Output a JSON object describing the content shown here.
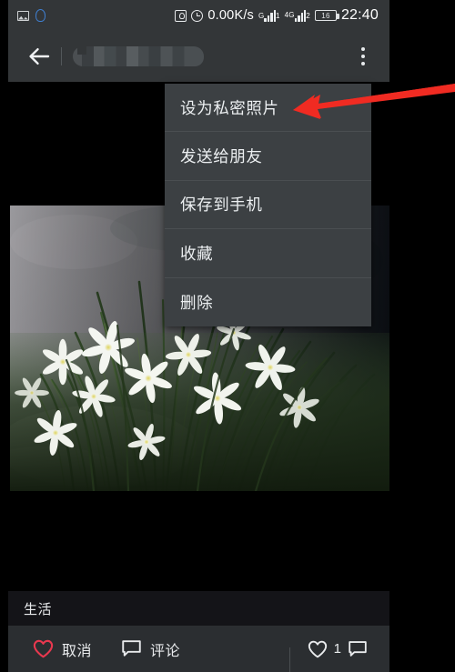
{
  "statusbar": {
    "icons_left": [
      "screenshot-icon",
      "qq-icon"
    ],
    "alarm_icon": "alarm-square-icon",
    "clock_icon": "clock-icon",
    "network_speed": "0.00K/s",
    "sim1_label": "G",
    "sim1_sub": "1",
    "sim2_label": "4G",
    "sim2_sub": "4G",
    "sim2_index": "2",
    "battery_level": "16",
    "time": "22:40"
  },
  "toolbar": {
    "back_icon": "back-arrow-icon",
    "title": "",
    "title_redacted": true,
    "overflow_icon": "overflow-menu-icon"
  },
  "menu": {
    "items": [
      {
        "label": "设为私密照片"
      },
      {
        "label": "发送给朋友"
      },
      {
        "label": "保存到手机"
      },
      {
        "label": "收藏"
      },
      {
        "label": "删除"
      }
    ]
  },
  "annotation": {
    "type": "arrow",
    "color": "#f02b22",
    "points_to": "设为私密照片"
  },
  "photo": {
    "alt": "白色葱兰花丛照片",
    "colors": {
      "grass_dark": "#1d2a18",
      "grass_mid": "#3f5a33",
      "grass_light": "#7f9a63",
      "stone": "#8f8f93",
      "flower": "#f4f6f0",
      "flower_center": "#d8cf5a"
    }
  },
  "caption": {
    "text": "生活"
  },
  "actionbar": {
    "like": {
      "icon": "heart-icon",
      "label": "取消",
      "color": "#e8384f"
    },
    "comment": {
      "icon": "comment-bubble-icon",
      "label": "评论"
    },
    "stats": {
      "like_icon": "heart-outline-icon",
      "like_count": "1",
      "comment_icon": "comment-bubble-icon"
    }
  },
  "colors": {
    "bar_bg": "#333638",
    "menu_bg": "#3c4043",
    "caption_bg": "#141418",
    "action_bg": "#2b2e31",
    "page_bg": "#000000",
    "accent_red": "#e8384f"
  }
}
